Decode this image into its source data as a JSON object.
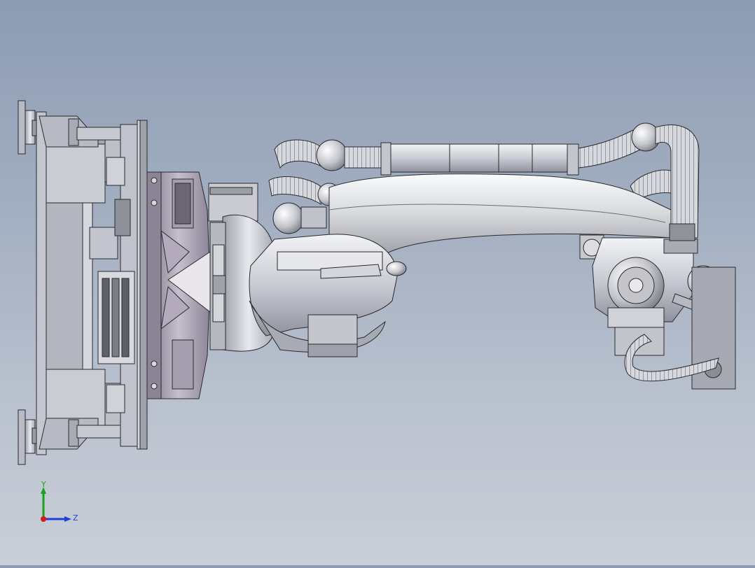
{
  "viewport": {
    "model": "industrial-robot-arm-assembly",
    "background_top": "#8d9cb3",
    "background_bottom": "#c9cfd8",
    "part_color": "#cdd0d8",
    "edge_color": "#2a2a2e"
  },
  "triad": {
    "y_label": "Y",
    "z_label": "Z",
    "y_color": "#1aa31a",
    "z_color": "#1f3fd6",
    "x_color": "#d21c1c"
  }
}
